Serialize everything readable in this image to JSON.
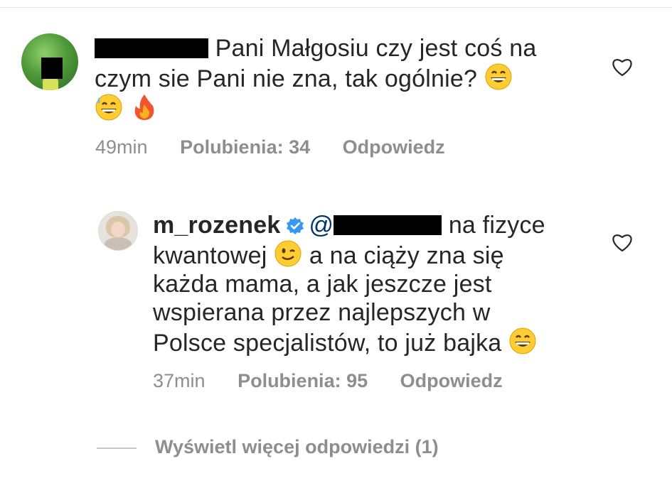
{
  "comment1": {
    "text_line1": "Pani Małgosiu czy jest coś na",
    "text_line2": "czym sie Pani nie zna, tak ogólnie?",
    "time": "49min",
    "likes": "Polubienia: 34",
    "reply": "Odpowiedz",
    "emojis": [
      "grinning-face-emoji",
      "grinning-sweat-face-emoji",
      "fire-emoji"
    ]
  },
  "comment2": {
    "username": "m_rozenek",
    "mention_prefix": "@",
    "text_part1": "na fizyce",
    "text_part2": "kwantowej",
    "text_part3": "a na ciąży zna się",
    "text_line3": "każda mama, a jak jeszcze jest",
    "text_line4": "wspierana przez najlepszych w",
    "text_line5": "Polsce specjalistów, to już bajka",
    "time": "37min",
    "likes": "Polubienia: 95",
    "reply": "Odpowiedz",
    "emojis": [
      "winking-face-emoji",
      "grinning-face-emoji"
    ]
  },
  "view_more": "Wyświetl więcej odpowiedzi (1)",
  "colors": {
    "text": "#262626",
    "meta": "#8e8e8e",
    "mention": "#003569",
    "verified": "#3897f0"
  }
}
